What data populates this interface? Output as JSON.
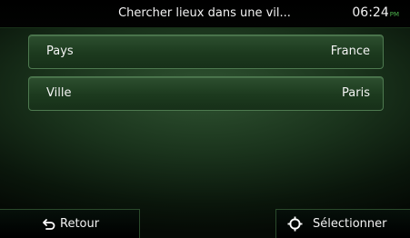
{
  "header": {
    "title": "Chercher lieux dans une vil...",
    "time": "06:24",
    "ampm": "PM"
  },
  "fields": [
    {
      "label": "Pays",
      "value": "France"
    },
    {
      "label": "Ville",
      "value": "Paris"
    }
  ],
  "footer": {
    "back_label": "Retour",
    "back_icon": "back-arrow-icon",
    "select_label": "Sélectionner",
    "select_icon": "crosshair-icon"
  },
  "colors": {
    "accent": "#4db24d"
  }
}
